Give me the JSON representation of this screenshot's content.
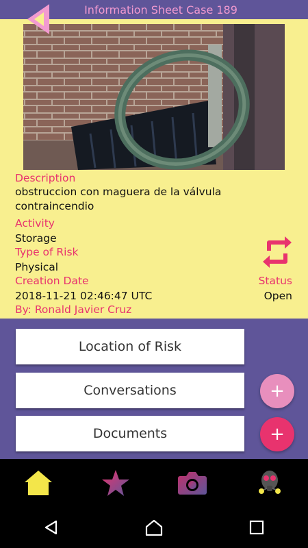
{
  "header": {
    "title": "Information Sheet Case 189"
  },
  "info": {
    "description_label": "Description",
    "description": "obstruccion con maguera de la válvula contraincendio",
    "activity_label": "Activity",
    "activity": "Storage",
    "risk_type_label": "Type of Risk",
    "risk_type": "Physical",
    "creation_date_label": "Creation Date",
    "creation_date": "2018-11-21 02:46:47 UTC",
    "author": "By: Ronald Javier Cruz",
    "status_label": "Status",
    "status": "Open"
  },
  "actions": {
    "location_label": "Location of Risk",
    "conversations_label": "Conversations",
    "documents_label": "Documents",
    "add_symbol": "+"
  },
  "bottom_nav": {
    "items": [
      {
        "icon": "home-icon"
      },
      {
        "icon": "star-icon"
      },
      {
        "icon": "camera-icon"
      },
      {
        "icon": "gas-mask-icon"
      }
    ]
  },
  "colors": {
    "header_bg": "#5f5599",
    "panel_bg": "#f8ef8f",
    "accent": "#e8336e",
    "fab_light": "#e88fbd",
    "fab_dark": "#e8336e",
    "home_yellow": "#f3e64a"
  }
}
